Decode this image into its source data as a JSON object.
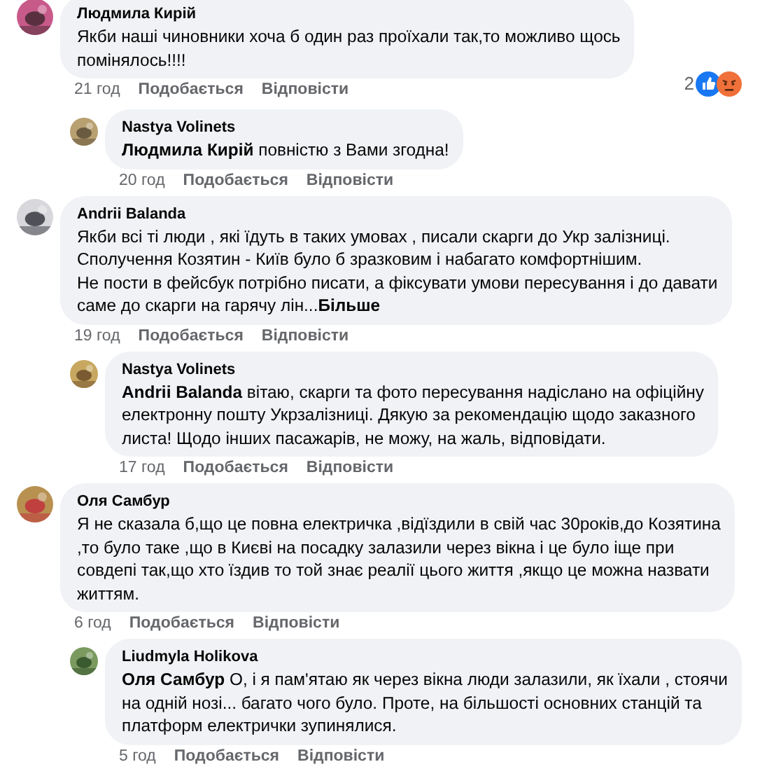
{
  "comments": [
    {
      "kind": "top",
      "author": "Людмила Кирій",
      "text": "Якби наші чиновники хоча б один раз проїхали так,то можливо щось\nпомінялось!!!!",
      "time": "21 год",
      "like": "Подобається",
      "reply": "Відповісти",
      "reaction_count": "2"
    },
    {
      "kind": "reply",
      "author": "Nastya Volinets",
      "text": "**Людмила Кирій** повністю з Вами згодна!",
      "time": "20 год",
      "like": "Подобається",
      "reply": "Відповісти"
    },
    {
      "kind": "top",
      "author": "Andrii Balanda",
      "text": "Якби всі ті люди , які їдуть в таких умовах , писали скарги до Укр залізниці.\nСполучення Козятин - Київ було б зразковим і набагато комфортнішим.\nНе пости в фейсбук потрібно писати, а фіксувати умови пересування і до давати\nсаме до скарги на гарячу лін...",
      "more": "Більше",
      "time": "19 год",
      "like": "Подобається",
      "reply": "Відповісти"
    },
    {
      "kind": "reply",
      "author": "Nastya Volinets",
      "text": "**Andrii Balanda** вітаю, скарги та фото пересування надіслано на офіційну\nелектронну пошту Укрзалізниці. Дякую за рекомендацію щодо заказного\nлиста! Щодо інших пасажарів, не можу, на жаль, відповідати.",
      "time": "17 год",
      "like": "Подобається",
      "reply": "Відповісти"
    },
    {
      "kind": "top",
      "author": "Оля Самбур",
      "text": "Я не сказала б,що це повна електричка ,відїздили в свій час 30років,до Козятина\n,то було таке ,що в Києві на посадку залазили через вікна і це було іще при\nсовдепі так,що хто їздив то той знає реалії цього життя ,якщо це можна назвати\nжиттям.",
      "time": "6 год",
      "like": "Подобається",
      "reply": "Відповісти"
    },
    {
      "kind": "reply",
      "author": "Liudmyla Holikova",
      "text": "**Оля Самбур** О, і я пам'ятаю як через вікна люди залазили, як їхали , стоячи\nна одній нозі... багато чого було. Проте, на більшості основних станцій та\nплатформ електрички зупинялися.",
      "time": "5 год",
      "like": "Подобається",
      "reply": "Відповісти"
    }
  ]
}
